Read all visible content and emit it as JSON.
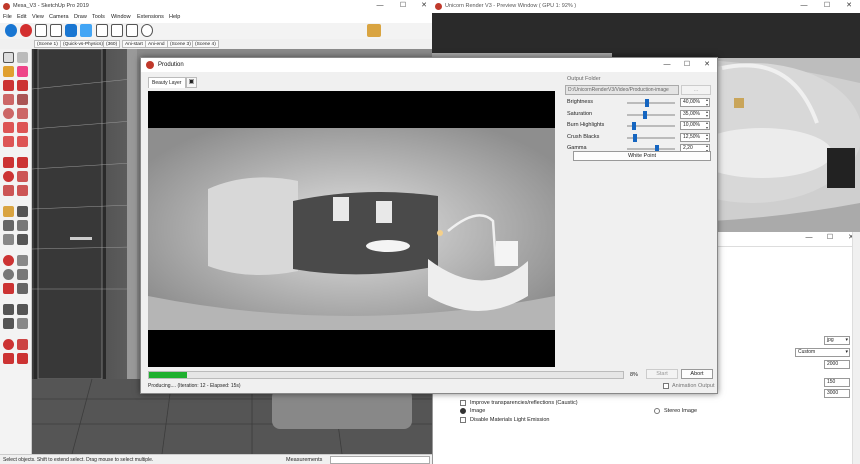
{
  "sketchup": {
    "title": "Mesa_V3 - SketchUp Pro 2019",
    "menu": [
      "File",
      "Edit",
      "View",
      "Camera",
      "Draw",
      "Tools",
      "Window",
      "Extensions",
      "Help"
    ],
    "scenes": [
      "(Scene 1)",
      "(Quick-vs-Physics)",
      "(360)",
      "Ani-start",
      "Ani-end",
      "(Scene 3)",
      "(Scene 4)"
    ],
    "status_text": "Select objects. Shift to extend select. Drag mouse to select multiple.",
    "measurements_label": "Measurements"
  },
  "preview": {
    "title": "Unicorn Render V3 - Preview Window ( GPU 1: 92% )"
  },
  "production": {
    "title": "Prodution",
    "tab_label": "Beauty Layer",
    "output_folder_label": "Output Folder",
    "output_folder_value": "D:/UnicornRenderV3/Video/Production-image",
    "browse_label": "...",
    "params": [
      {
        "label": "Brightness",
        "value": "40,00%",
        "level": 0.4
      },
      {
        "label": "Saturation",
        "value": "35,00%",
        "level": 0.35
      },
      {
        "label": "Burn Highlights",
        "value": "10,00%",
        "level": 0.1
      },
      {
        "label": "Crush Blacks",
        "value": "12,50%",
        "level": 0.125
      },
      {
        "label": "Gamma",
        "value": "2,20",
        "level": 0.6
      }
    ],
    "white_point_label": "White Point",
    "progress": 0.08,
    "progress_label": "8%",
    "start_label": "Start",
    "abort_label": "Abort",
    "status": "Producing.... (Iteration: 12 - Elapsed: 15s)",
    "animation_output_label": "Animation Output"
  },
  "backwin": {
    "format_value": "jpg",
    "preset_value": "Custom",
    "width_value": "2000",
    "spin1_value": "150",
    "spin2_value": "3000",
    "caustic_label": "Improve transparencies/reflections (Caustic)",
    "image_label": "Image",
    "stereo_label": "Stereo Image",
    "disable_light_label": "Disable Materials Light Emission"
  },
  "colors": {
    "accent_blue": "#1565c0",
    "progress_green": "#1fb02f",
    "brand_red": "#c0392b"
  }
}
